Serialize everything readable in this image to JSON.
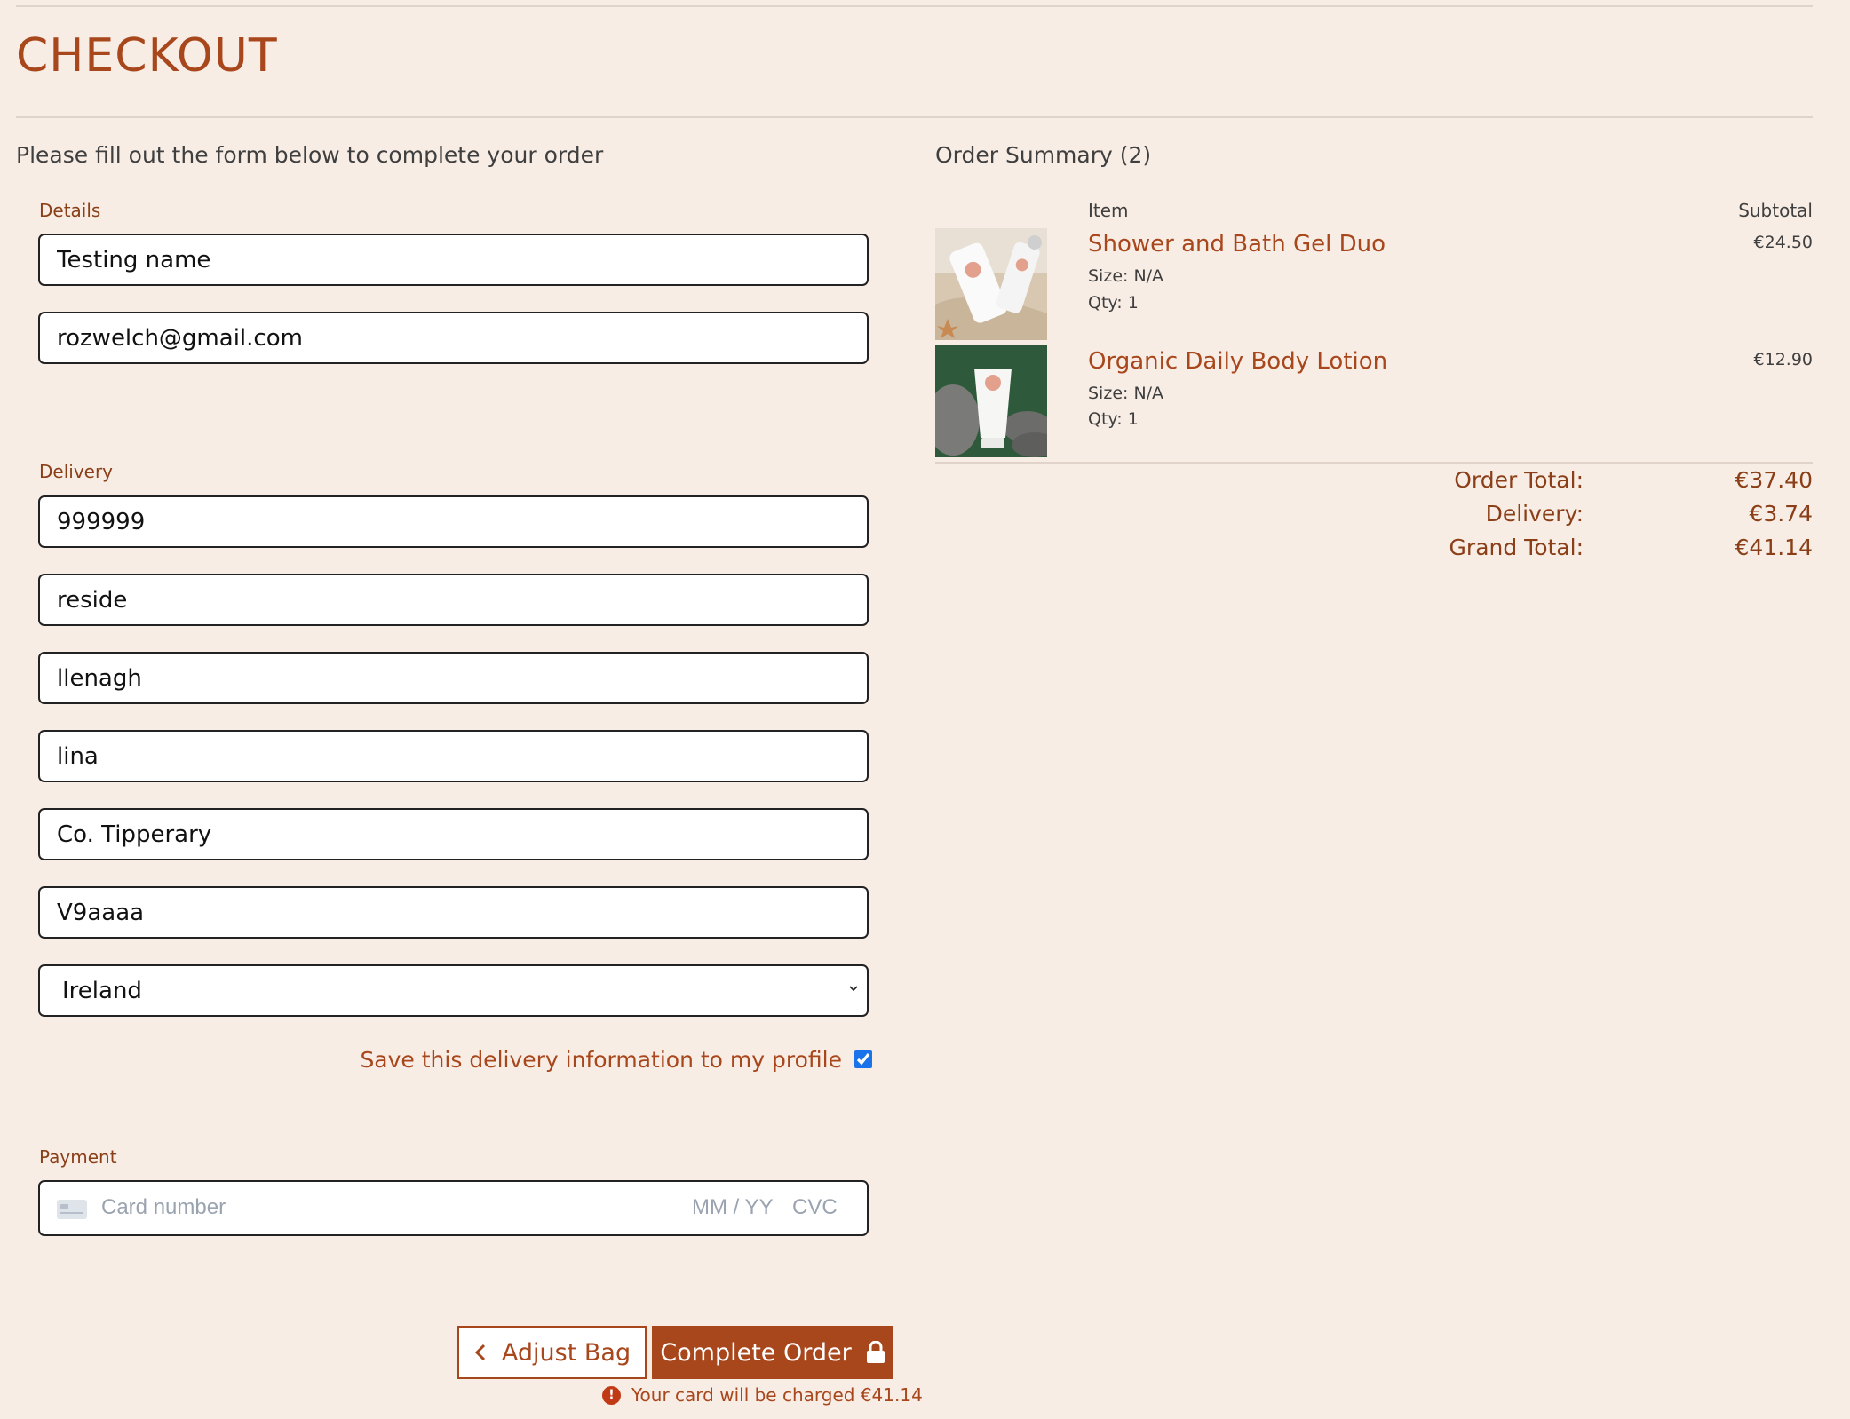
{
  "page": {
    "title": "CHECKOUT",
    "intro": "Please fill out the form below to complete your order"
  },
  "details": {
    "label": "Details",
    "full_name": "Testing name",
    "email": "rozwelch@gmail.com"
  },
  "delivery": {
    "label": "Delivery",
    "phone": "999999",
    "street_address1": "reside",
    "street_address2": "llenagh",
    "town": "lina",
    "county": "Co. Tipperary",
    "postcode": "V9aaaa",
    "country": "Ireland",
    "save_label": "Save this delivery information to my profile",
    "save_checked": true
  },
  "payment": {
    "label": "Payment",
    "card_placeholder": "Card number",
    "expiry_placeholder": "MM / YY",
    "cvc_placeholder": "CVC"
  },
  "actions": {
    "adjust_label": "Adjust Bag",
    "complete_label": "Complete Order",
    "charge_note": "Your card will be charged €41.14"
  },
  "summary": {
    "title": "Order Summary (2)",
    "item_header": "Item",
    "subtotal_header": "Subtotal",
    "items": [
      {
        "name": "Shower and Bath Gel Duo",
        "size": "Size: N/A",
        "qty": "Qty: 1",
        "price": "€24.50"
      },
      {
        "name": "Organic Daily Body Lotion",
        "size": "Size: N/A",
        "qty": "Qty: 1",
        "price": "€12.90"
      }
    ],
    "order_total_label": "Order Total:",
    "order_total": "€37.40",
    "delivery_label": "Delivery:",
    "delivery": "€3.74",
    "grand_total_label": "Grand Total:",
    "grand_total": "€41.14"
  },
  "colors": {
    "background": "#f8ede5",
    "accent": "#a8461c",
    "checkbox": "#1a73e8"
  },
  "icons": [
    "credit-card-icon",
    "chevron-left-icon",
    "lock-icon",
    "exclamation-icon",
    "chevron-down-icon"
  ]
}
